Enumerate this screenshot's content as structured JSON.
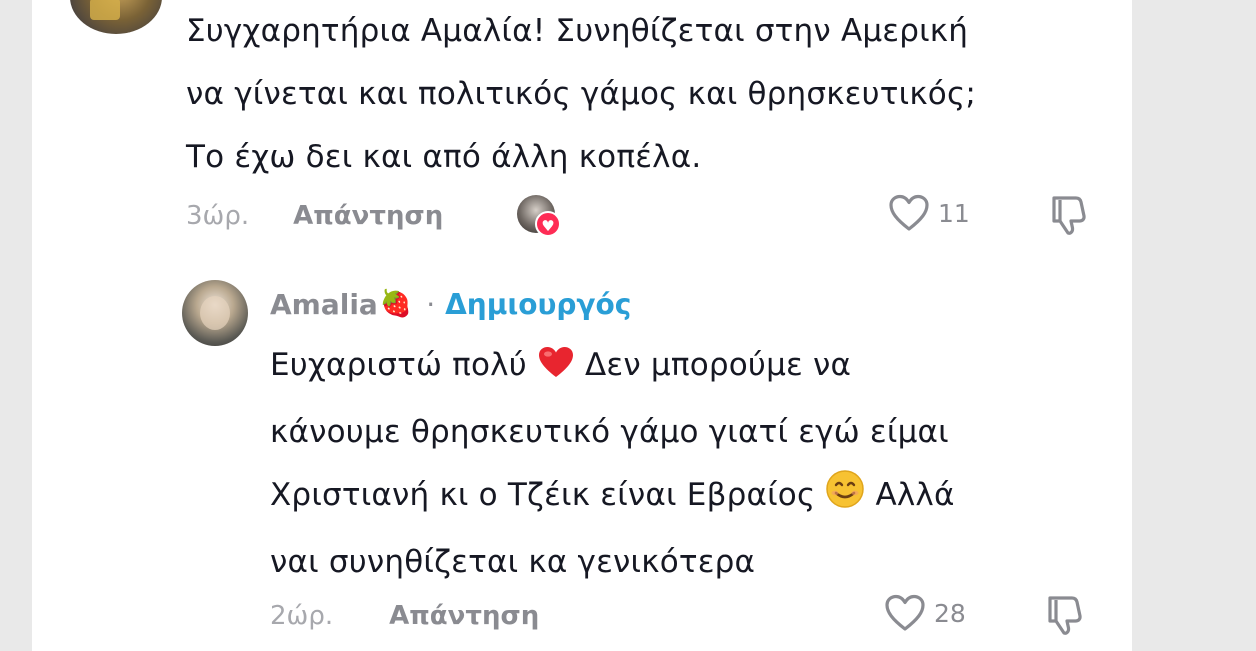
{
  "comment": {
    "lines": [
      "Συγχαρητήρια Αμαλία! Συνηθίζεται στην Αμερική",
      "να γίνεται και πολιτικός γάμος και θρησκευτικός;",
      "Το έχω δει και από άλλη κοπέλα."
    ],
    "time": "3ώρ.",
    "reply_label": "Απάντηση",
    "likes": "11"
  },
  "reply": {
    "author": "Amalia",
    "author_emoji": "🍓",
    "separator": "·",
    "badge": "Δημιουργός",
    "line1_a": "Ευχαριστώ πολύ",
    "line1_emoji": "❤️",
    "line1_b": "Δεν μπορούμε να",
    "line2": "κάνουμε θρησκευτικό γάμο γιατί εγώ είμαι",
    "line3_a": "Χριστιανή κι ο Τζέικ είναι Εβραίος",
    "line3_emoji": "😊",
    "line3_b": "Αλλά",
    "line4": "ναι συνηθίζεται κα γενικότερα",
    "time": "2ώρ.",
    "reply_label": "Απάντηση",
    "likes": "28"
  },
  "icons": {
    "like": "heart-outline-icon",
    "dislike": "thumbs-down-icon",
    "creator_liked": "heart-badge-icon"
  },
  "colors": {
    "text": "#161823",
    "muted": "#8a8b91",
    "creator_badge": "#2a9ed6",
    "heart_badge": "#fe2c55"
  }
}
